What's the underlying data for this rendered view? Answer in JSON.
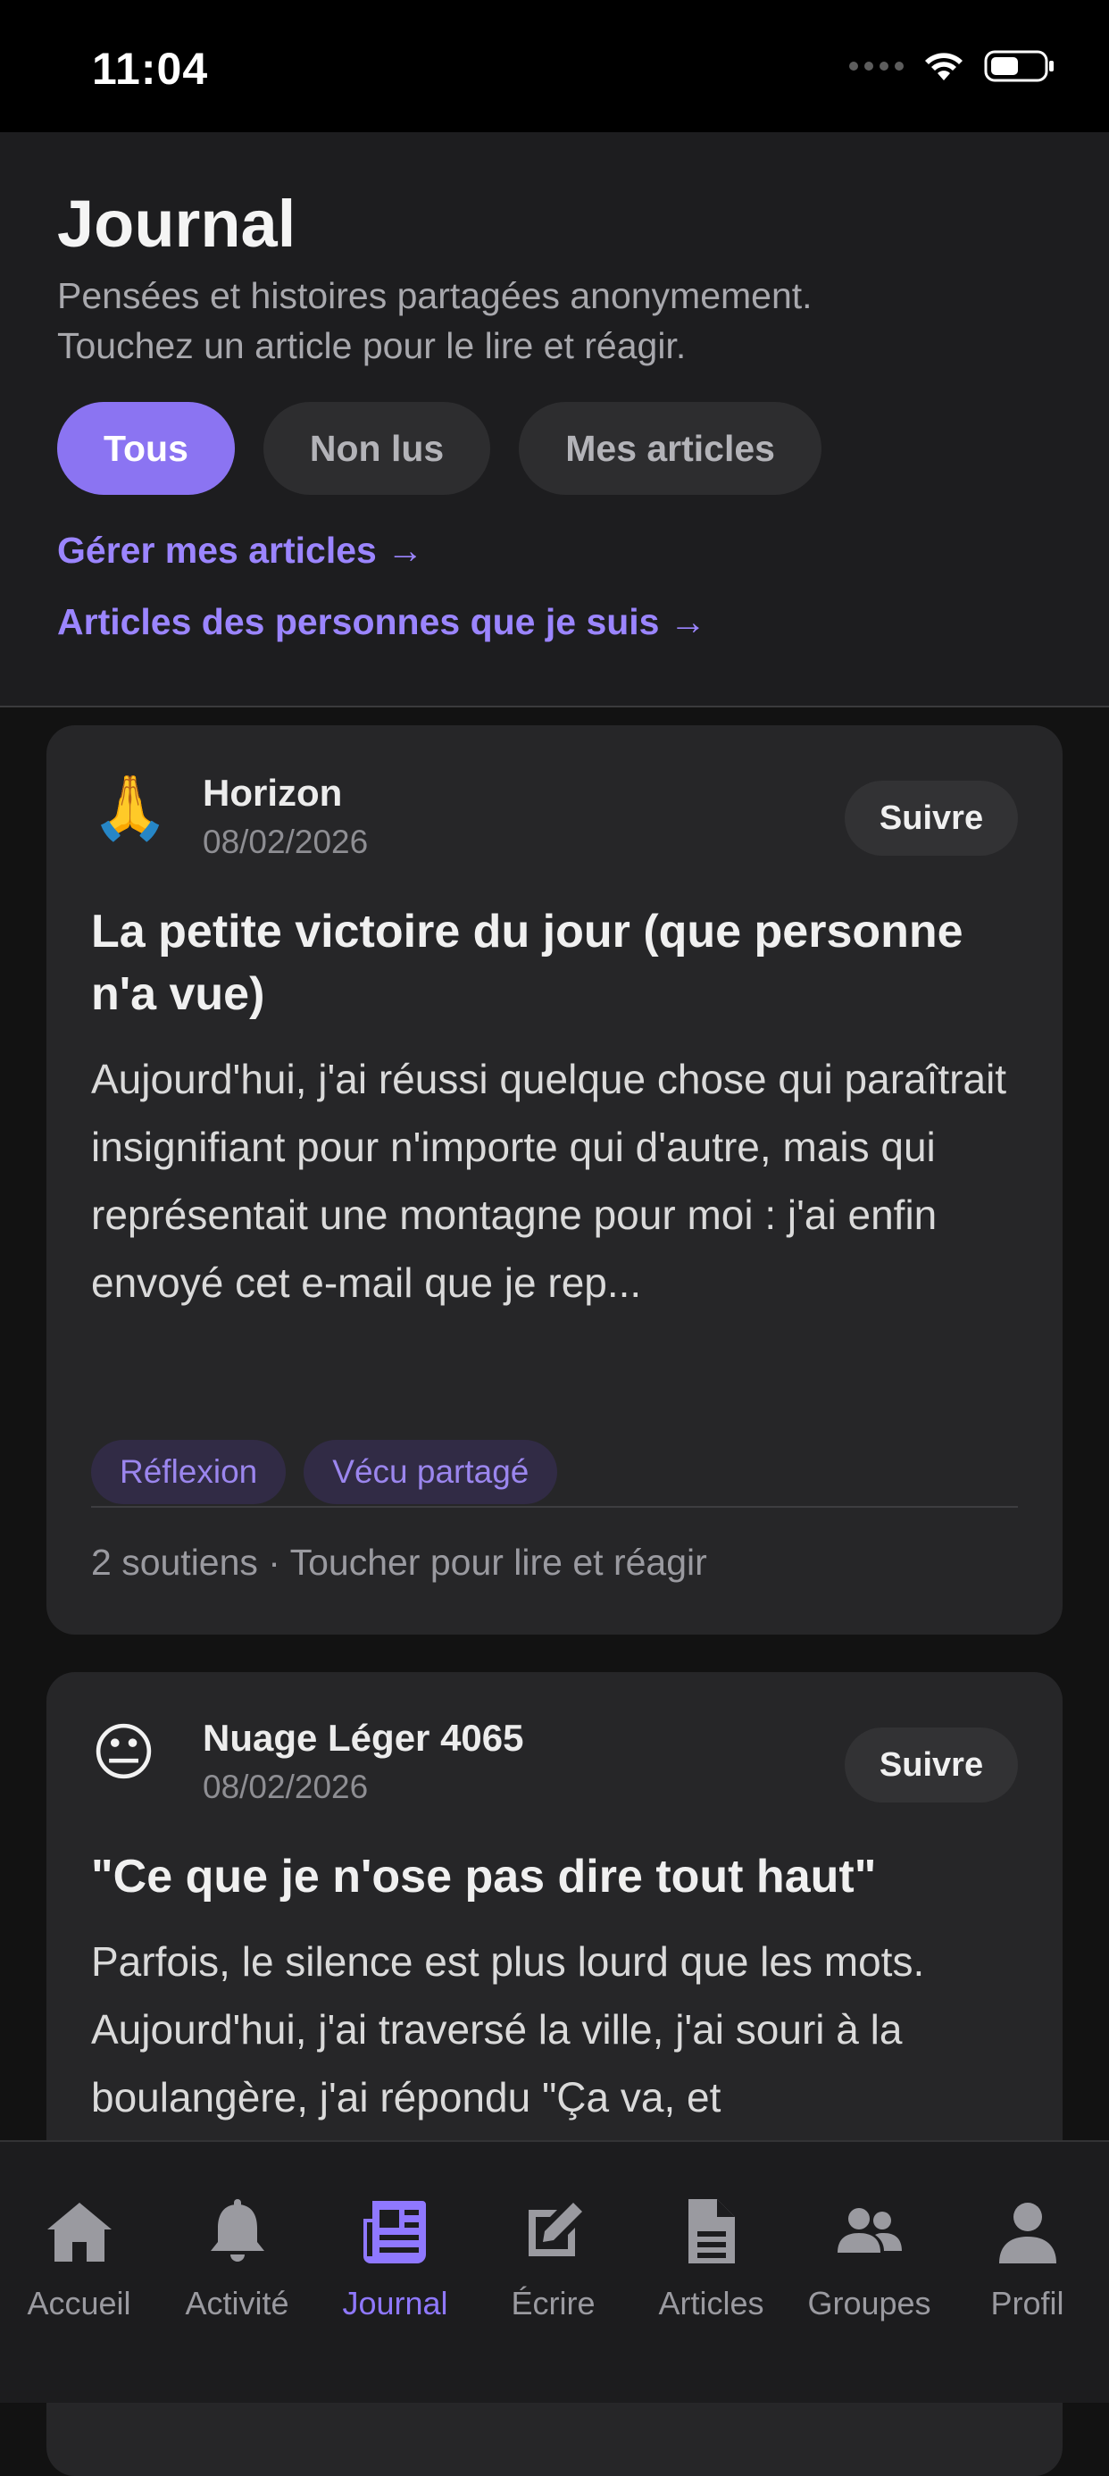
{
  "status_bar": {
    "time": "11:04"
  },
  "header": {
    "title": "Journal",
    "subtitle_line1": "Pensées et histoires partagées anonymement.",
    "subtitle_line2": "Touchez un article pour le lire et réagir.",
    "filters": [
      {
        "label": "Tous",
        "active": true
      },
      {
        "label": "Non lus",
        "active": false
      },
      {
        "label": "Mes articles",
        "active": false
      }
    ],
    "link_manage": "Gérer mes articles →",
    "link_following": "Articles des personnes que je suis →"
  },
  "articles": [
    {
      "avatar_emoji": "🙏",
      "author": "Horizon",
      "date": "08/02/2026",
      "follow_label": "Suivre",
      "title": "La petite victoire du jour (que personne n'a vue)",
      "excerpt": "Aujourd'hui, j'ai réussi quelque chose qui paraîtrait insignifiant pour n'importe qui d'autre, mais qui représentait une montagne pour moi : j'ai enfin envoyé cet e-mail que je rep...",
      "tags": [
        "Réflexion",
        "Vécu partagé"
      ],
      "footer": "2 soutiens · Toucher pour lire et réagir"
    },
    {
      "avatar_emoji": "😐",
      "author": "Nuage Léger 4065",
      "date": "08/02/2026",
      "follow_label": "Suivre",
      "title": "\"Ce que je n'ose pas dire tout haut\"",
      "excerpt": "Parfois, le silence est plus lourd que les mots. Aujourd'hui, j'ai traversé la ville, j'ai souri à la boulangère, j'ai répondu \"Ça va, et"
    }
  ],
  "tab_bar": {
    "active_color": "#8f78ff",
    "inactive_color": "#9a9aa0",
    "tabs": [
      {
        "label": "Accueil",
        "icon": "home-icon"
      },
      {
        "label": "Activité",
        "icon": "bell-icon"
      },
      {
        "label": "Journal",
        "icon": "newspaper-icon",
        "active": true
      },
      {
        "label": "Écrire",
        "icon": "edit-icon"
      },
      {
        "label": "Articles",
        "icon": "document-icon"
      },
      {
        "label": "Groupes",
        "icon": "users-icon"
      },
      {
        "label": "Profil",
        "icon": "user-icon"
      }
    ]
  }
}
